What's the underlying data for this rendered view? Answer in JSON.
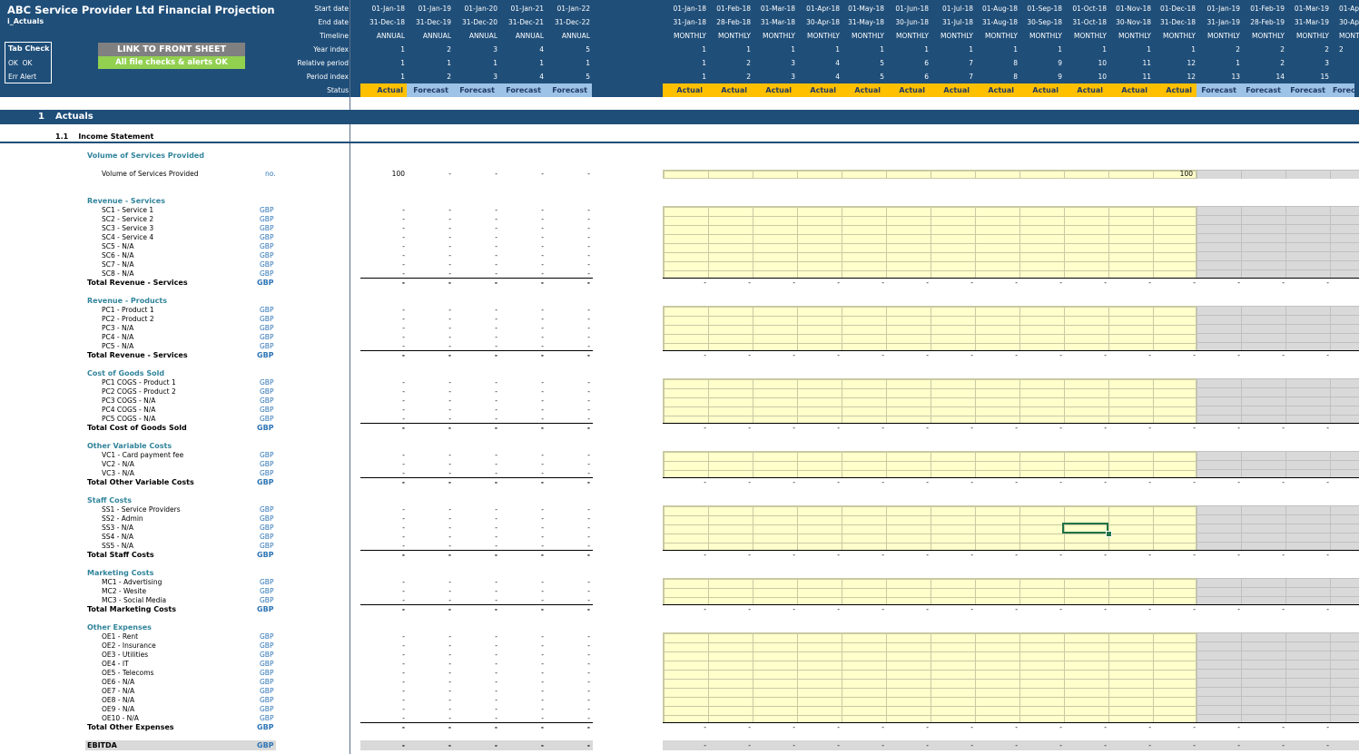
{
  "title": "ABC Service Provider Ltd Financial Projection",
  "sheet_name": "i_Actuals",
  "tab_check": {
    "label": "Tab Check",
    "ok1": "OK",
    "ok2": "OK",
    "err": "Err Alert"
  },
  "link_button": "LINK TO FRONT SHEET",
  "file_check": "All file checks & alerts OK",
  "header_labels": [
    "Start date",
    "End date",
    "Timeline",
    "Year index",
    "Relative period",
    "Period index",
    "Status"
  ],
  "annual": {
    "start": [
      "01-Jan-18",
      "01-Jan-19",
      "01-Jan-20",
      "01-Jan-21",
      "01-Jan-22"
    ],
    "end": [
      "31-Dec-18",
      "31-Dec-19",
      "31-Dec-20",
      "31-Dec-21",
      "31-Dec-22"
    ],
    "timeline": [
      "ANNUAL",
      "ANNUAL",
      "ANNUAL",
      "ANNUAL",
      "ANNUAL"
    ],
    "year_index": [
      "1",
      "2",
      "3",
      "4",
      "5"
    ],
    "relative": [
      "1",
      "1",
      "1",
      "1",
      "1"
    ],
    "period": [
      "1",
      "2",
      "3",
      "4",
      "5"
    ],
    "status": [
      "Actual",
      "Forecast",
      "Forecast",
      "Forecast",
      "Forecast"
    ]
  },
  "monthly": {
    "start": [
      "01-Jan-18",
      "01-Feb-18",
      "01-Mar-18",
      "01-Apr-18",
      "01-May-18",
      "01-Jun-18",
      "01-Jul-18",
      "01-Aug-18",
      "01-Sep-18",
      "01-Oct-18",
      "01-Nov-18",
      "01-Dec-18",
      "01-Jan-19",
      "01-Feb-19",
      "01-Mar-19",
      "01-Ap"
    ],
    "end": [
      "31-Jan-18",
      "28-Feb-18",
      "31-Mar-18",
      "30-Apr-18",
      "31-May-18",
      "30-Jun-18",
      "31-Jul-18",
      "31-Aug-18",
      "30-Sep-18",
      "31-Oct-18",
      "30-Nov-18",
      "31-Dec-18",
      "31-Jan-19",
      "28-Feb-19",
      "31-Mar-19",
      "30-Ap"
    ],
    "timeline": [
      "MONTHLY",
      "MONTHLY",
      "MONTHLY",
      "MONTHLY",
      "MONTHLY",
      "MONTHLY",
      "MONTHLY",
      "MONTHLY",
      "MONTHLY",
      "MONTHLY",
      "MONTHLY",
      "MONTHLY",
      "MONTHLY",
      "MONTHLY",
      "MONTHLY",
      "MONT"
    ],
    "year_index": [
      "1",
      "1",
      "1",
      "1",
      "1",
      "1",
      "1",
      "1",
      "1",
      "1",
      "1",
      "1",
      "2",
      "2",
      "2",
      "2"
    ],
    "relative": [
      "1",
      "2",
      "3",
      "4",
      "5",
      "6",
      "7",
      "8",
      "9",
      "10",
      "11",
      "12",
      "1",
      "2",
      "3",
      ""
    ],
    "period": [
      "1",
      "2",
      "3",
      "4",
      "5",
      "6",
      "7",
      "8",
      "9",
      "10",
      "11",
      "12",
      "13",
      "14",
      "15",
      ""
    ],
    "status": [
      "Actual",
      "Actual",
      "Actual",
      "Actual",
      "Actual",
      "Actual",
      "Actual",
      "Actual",
      "Actual",
      "Actual",
      "Actual",
      "Actual",
      "Forecast",
      "Forecast",
      "Forecast",
      "Forec"
    ]
  },
  "section": {
    "num": "1",
    "title": "Actuals"
  },
  "subsection": {
    "num": "1.1",
    "title": "Income Statement"
  },
  "dash": "-",
  "volume": {
    "heading": "Volume of Services Provided",
    "label": "Volume of Services Provided",
    "unit": "no.",
    "annual_value": "100",
    "dec_value": "100"
  },
  "groups": [
    {
      "heading": "Revenue - Services",
      "items": [
        "SC1 - Service 1",
        "SC2 - Service 2",
        "SC3 - Service 3",
        "SC4 - Service 4",
        "SC5 - N/A",
        "SC6 - N/A",
        "SC7 - N/A",
        "SC8 - N/A"
      ],
      "unit": "GBP",
      "total": "Total Revenue - Services"
    },
    {
      "heading": "Revenue - Products",
      "items": [
        "PC1 - Product 1",
        "PC2 - Product 2",
        "PC3 - N/A",
        "PC4 - N/A",
        "PC5 - N/A"
      ],
      "unit": "GBP",
      "total": "Total Revenue - Services"
    },
    {
      "heading": "Cost of Goods Sold",
      "items": [
        "PC1 COGS - Product 1",
        "PC2 COGS - Product 2",
        "PC3 COGS - N/A",
        "PC4 COGS - N/A",
        "PC5 COGS - N/A"
      ],
      "unit": "GBP",
      "total": "Total Cost of Goods Sold"
    },
    {
      "heading": "Other Variable Costs",
      "items": [
        "VC1 - Card payment fee",
        "VC2 - N/A",
        "VC3 - N/A"
      ],
      "unit": "GBP",
      "total": "Total Other Variable Costs"
    },
    {
      "heading": "Staff Costs",
      "items": [
        "SS1 - Service Providers",
        "SS2 - Admin",
        "SS3 - N/A",
        "SS4 - N/A",
        "SS5 - N/A"
      ],
      "unit": "GBP",
      "total": "Total Staff Costs"
    },
    {
      "heading": "Marketing Costs",
      "items": [
        "MC1 - Advertising",
        "MC2 - Wesite",
        "MC3 - Social Media"
      ],
      "unit": "GBP",
      "total": "Total Marketing Costs"
    },
    {
      "heading": "Other Expenses",
      "items": [
        "OE1 - Rent",
        "OE2 - Insurance",
        "OE3 - Utilities",
        "OE4 - IT",
        "OE5 - Telecoms",
        "OE6 - N/A",
        "OE7 - N/A",
        "OE8 - N/A",
        "OE9 - N/A",
        "OE10 - N/A"
      ],
      "unit": "GBP",
      "total": "Total Other Expenses"
    }
  ],
  "ebitda": {
    "label": "EBITDA",
    "unit": "GBP"
  }
}
